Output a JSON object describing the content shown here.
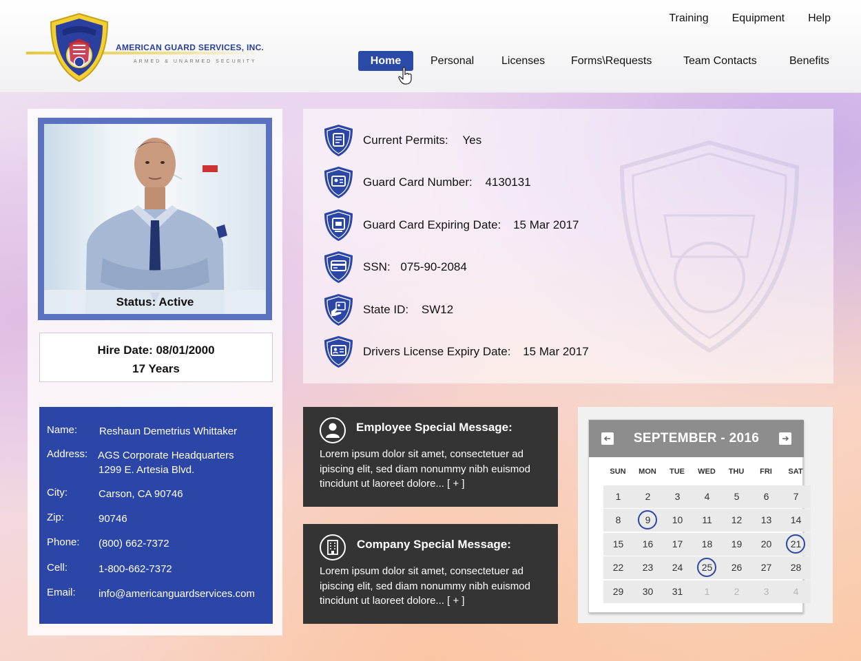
{
  "brand": {
    "name": "AMERICAN GUARD SERVICES, INC.",
    "tagline": "ARMED & UNARMED SECURITY"
  },
  "top_nav": [
    "Training",
    "Equipment",
    "Help"
  ],
  "main_nav": [
    "Home",
    "Personal",
    "Licenses",
    "Forms\\Requests",
    "Team Contacts",
    "Benefits"
  ],
  "profile": {
    "status": "Status: Active",
    "hire_date": "Hire Date: 08/01/2000",
    "tenure": "17 Years"
  },
  "contact": {
    "name_label": "Name:",
    "name": "Reshaun Demetrius Whittaker",
    "address_label": "Address:",
    "address_line1": "AGS Corporate Headquarters",
    "address_line2": "1299 E. Artesia Blvd.",
    "city_label": "City:",
    "city": "Carson, CA 90746",
    "zip_label": "Zip:",
    "zip": "90746",
    "phone_label": "Phone:",
    "phone": "(800) 662-7372",
    "cell_label": "Cell:",
    "cell": "1-800-662-7372",
    "email_label": "Email:",
    "email": "info@americanguardservices.com"
  },
  "details": [
    {
      "label": "Current Permits:",
      "value": "Yes",
      "icon": "scroll-icon"
    },
    {
      "label": "Guard Card Number:",
      "value": "4130131",
      "icon": "id-card-icon"
    },
    {
      "label": "Guard Card Expiring Date:",
      "value": "15 Mar 2017",
      "icon": "calendar-card-icon"
    },
    {
      "label": "SSN:",
      "value": "075-90-2084",
      "icon": "credit-card-icon"
    },
    {
      "label": "State ID:",
      "value": "SW12",
      "icon": "hand-id-icon"
    },
    {
      "label": "Drivers License Expiry Date:",
      "value": "15 Mar 2017",
      "icon": "license-icon"
    }
  ],
  "messages": {
    "employee": {
      "title": "Employee Special Message:",
      "body": "Lorem ipsum dolor sit amet, consectetuer ad ipiscing elit, sed diam nonummy nibh euismod tincidunt ut laoreet dolore... [ + ]"
    },
    "company": {
      "title": "Company Special Message:",
      "body": "Lorem ipsum dolor sit amet, consectetuer ad ipiscing elit, sed diam nonummy nibh euismod tincidunt ut laoreet dolore... [ + ]"
    }
  },
  "calendar": {
    "title": "SEPTEMBER - 2016",
    "weekdays": [
      "SUN",
      "MON",
      "TUE",
      "WED",
      "THU",
      "FRI",
      "SAT"
    ],
    "weeks": [
      [
        "1",
        "2",
        "3",
        "4",
        "5",
        "6",
        "7"
      ],
      [
        "8",
        "9",
        "10",
        "11",
        "12",
        "13",
        "14"
      ],
      [
        "15",
        "16",
        "17",
        "18",
        "19",
        "20",
        "21"
      ],
      [
        "22",
        "23",
        "24",
        "25",
        "26",
        "27",
        "28"
      ],
      [
        "29",
        "30",
        "31",
        "1",
        "2",
        "3",
        "4"
      ]
    ],
    "highlighted": [
      "9",
      "21",
      "25"
    ],
    "accent": "#2b46a6"
  }
}
